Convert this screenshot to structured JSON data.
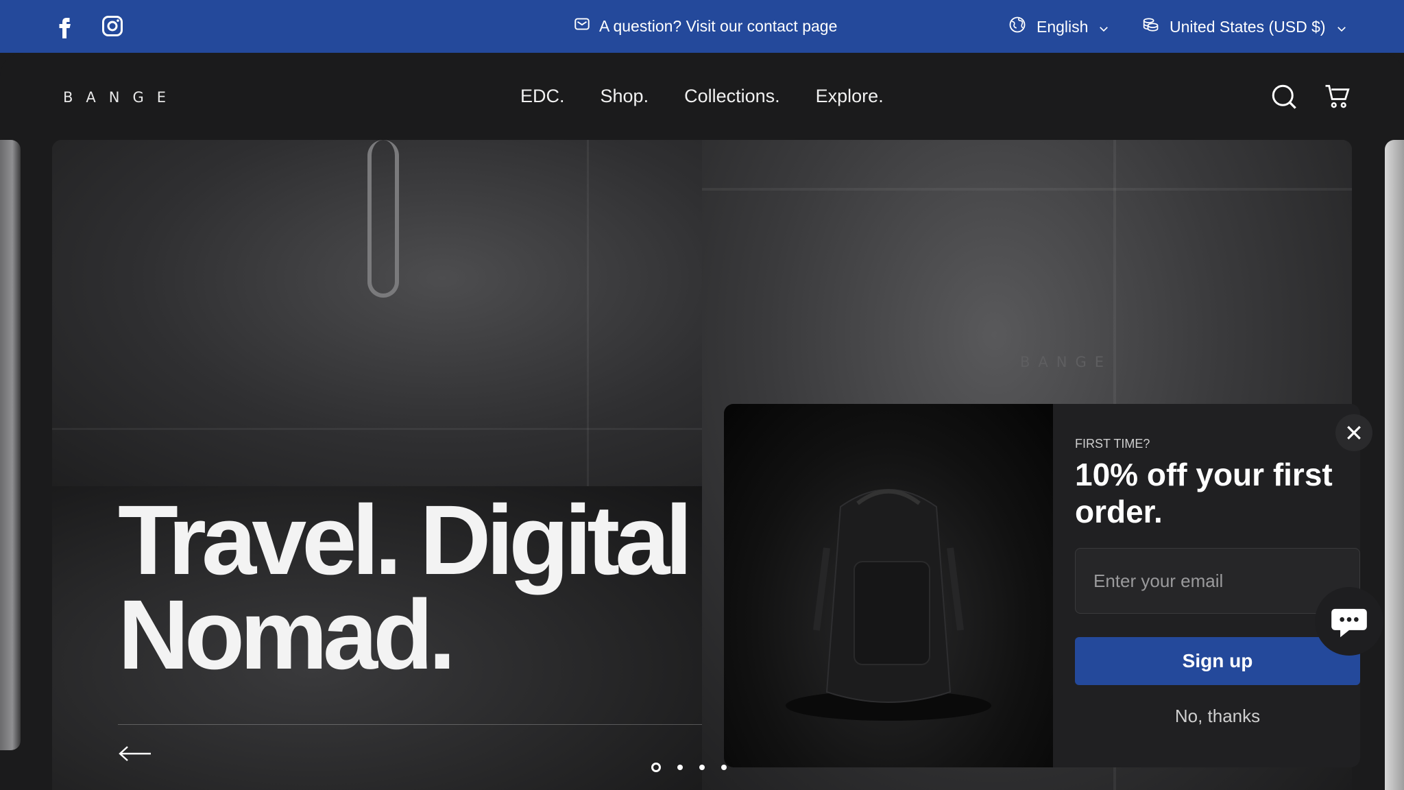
{
  "topbar": {
    "contact_text": "A question? Visit our contact page",
    "language": "English",
    "currency": "United States (USD $)",
    "icons": [
      "facebook-icon",
      "instagram-icon",
      "mail-icon",
      "globe-icon",
      "coins-icon",
      "chevron-down-icon"
    ]
  },
  "header": {
    "logo": "BANGE",
    "nav": [
      "EDC.",
      "Shop.",
      "Collections.",
      "Explore."
    ],
    "icons": [
      "search-icon",
      "cart-icon"
    ]
  },
  "hero": {
    "headline_line1": "Travel. Digital",
    "headline_line2": "Nomad.",
    "bag_brand": "BANGE",
    "slides": 4,
    "active_slide": 1
  },
  "popup": {
    "eyebrow": "FIRST TIME?",
    "offer": "10% off your first order.",
    "email_placeholder": "Enter your email",
    "signup_label": "Sign up",
    "dismiss_label": "No, thanks"
  },
  "colors": {
    "brand_blue": "#24499b",
    "background": "#1b1b1c"
  }
}
